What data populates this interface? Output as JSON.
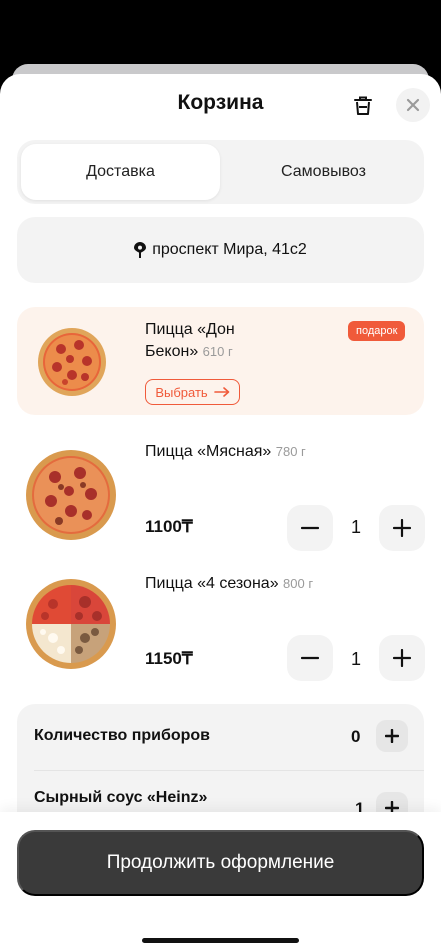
{
  "header": {
    "title": "Корзина"
  },
  "tabs": {
    "delivery": "Доставка",
    "pickup": "Самовывоз"
  },
  "address": {
    "text": "проспект Мира, 41с2"
  },
  "gift": {
    "name_line1": "Пицца «Дон",
    "name_line2": "Бекон»",
    "weight": "610 г",
    "badge": "подарок",
    "choose_label": "Выбрать"
  },
  "items": [
    {
      "name": "Пицца «Мясная»",
      "weight": "780 г",
      "price": "1100₸",
      "qty": "1"
    },
    {
      "name": "Пицца «4 сезона»",
      "weight": "800 г",
      "price": "1150₸",
      "qty": "1"
    }
  ],
  "extras": {
    "cutlery_label": "Количество приборов",
    "cutlery_qty": "0",
    "sauce_label": "Сырный соус «Heinz»",
    "sauce_qty": "1"
  },
  "footer": {
    "continue_label": "Продолжить оформление"
  },
  "colors": {
    "accent": "#f05a3a",
    "gift_bg": "#fdf3ec",
    "button_dark": "#3a3a3a"
  }
}
